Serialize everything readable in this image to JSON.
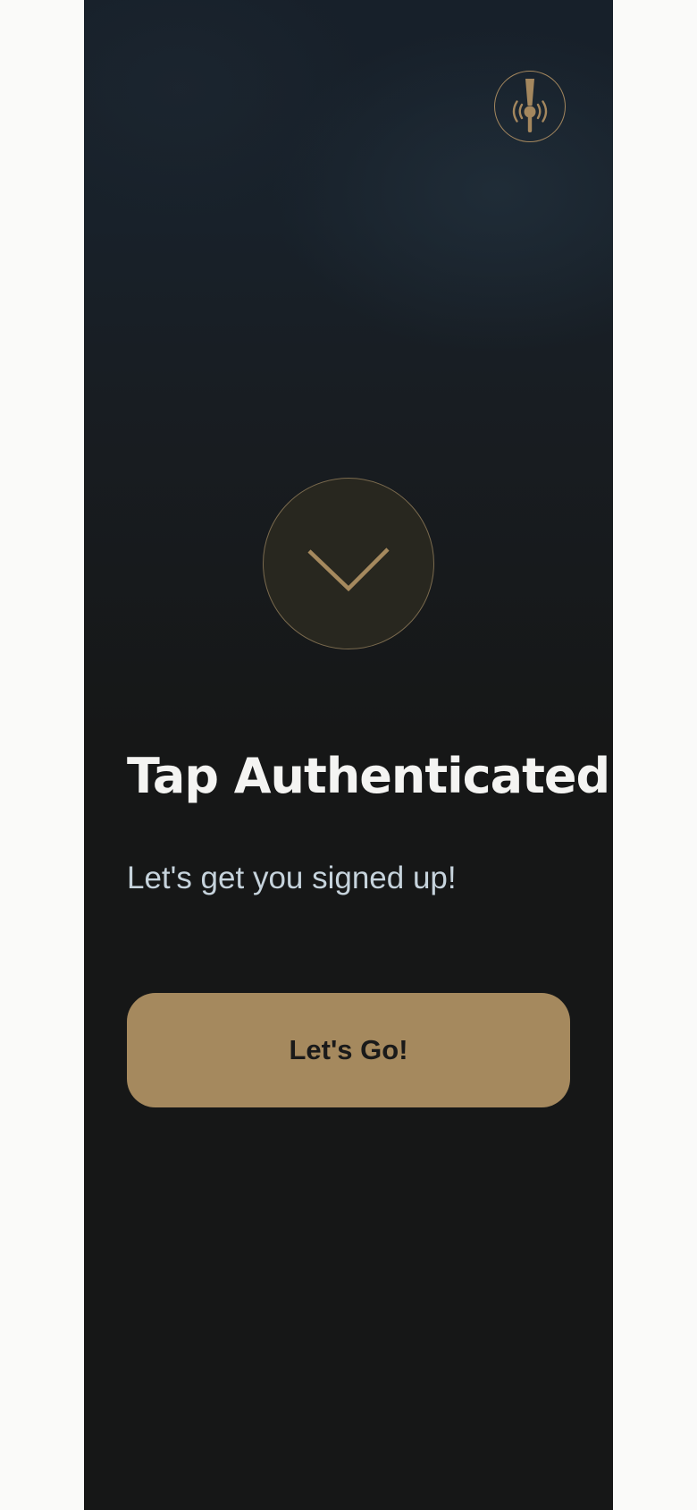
{
  "colors": {
    "page_bg": "#fafaf9",
    "screen_bg": "#161717",
    "accent": "#a5895e",
    "title_text": "#f4f4f2",
    "subtitle_text": "#c6d3dc",
    "button_text": "#1a1a1a"
  },
  "header": {
    "logo_icon": "beer-tap-nfc-icon"
  },
  "status": {
    "icon": "checkmark-icon",
    "title": "Tap Authenticated",
    "subtitle": "Let's get you signed up!"
  },
  "actions": {
    "primary_label": "Let's Go!"
  }
}
